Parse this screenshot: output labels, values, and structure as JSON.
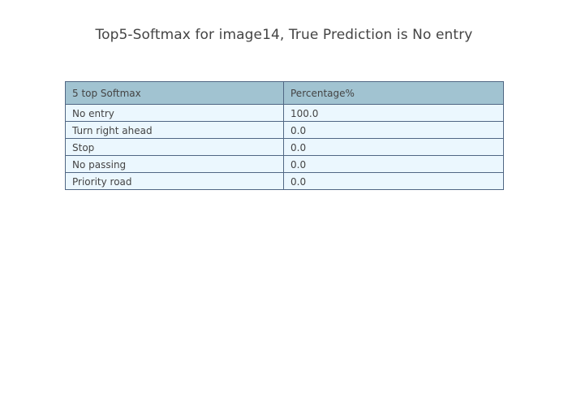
{
  "chart_data": {
    "type": "table",
    "title": "Top5-Softmax for image14, True Prediction is No entry",
    "columns": [
      "5 top Softmax",
      "Percentage%"
    ],
    "rows": [
      [
        "No entry",
        "100.0"
      ],
      [
        "Turn right ahead",
        "0.0"
      ],
      [
        "Stop",
        "0.0"
      ],
      [
        "No passing",
        "0.0"
      ],
      [
        "Priority road",
        "0.0"
      ]
    ],
    "colors": {
      "header_fill": "#a1c3d1",
      "cell_fill": "#ebf7fe",
      "line": "#506784"
    }
  }
}
